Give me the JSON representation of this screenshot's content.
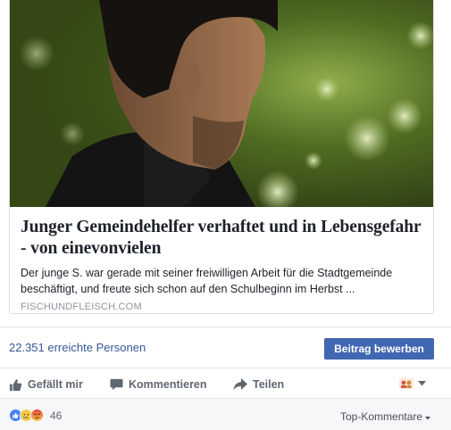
{
  "link_preview": {
    "title": "Junger Gemeindehelfer verhaftet und in Lebensgefahr - von einevonvielen",
    "description": "Der junge S. war gerade mit seiner freiwilligen Arbeit für die Stadtgemeinde beschäftigt, und freute sich schon auf den Schulbeginn im Herbst ...",
    "domain": "FISCHUNDFLEISCH.COM"
  },
  "insights": {
    "reach_label": "22.351 erreichte Personen",
    "boost_label": "Beitrag bewerben"
  },
  "actions": {
    "like_label": "Gefällt mir",
    "comment_label": "Kommentieren",
    "share_label": "Teilen"
  },
  "reactions": {
    "types": [
      "like-icon",
      "sad-icon",
      "angry-icon"
    ],
    "count": "46"
  },
  "comments": {
    "sort_label": "Top-Kommentare"
  },
  "colors": {
    "link_blue": "#365899",
    "button_blue": "#4267b2",
    "action_gray": "#606770",
    "bar_background": "#f6f7f9"
  }
}
